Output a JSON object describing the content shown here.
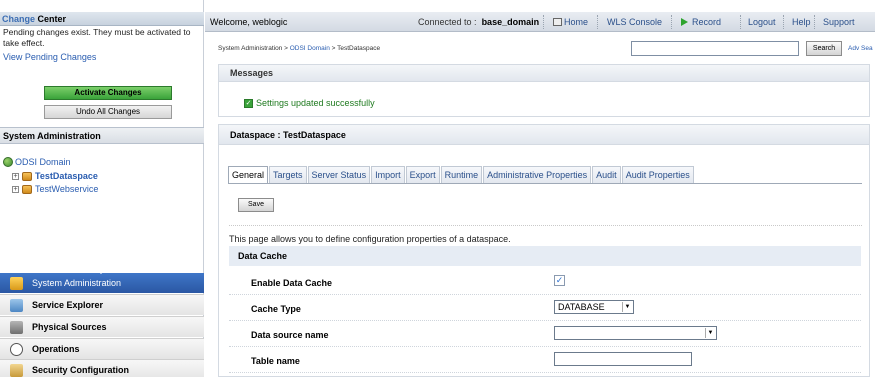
{
  "change_center": {
    "title_prefix": "Change",
    "title_rest": " Center",
    "message": "Pending changes exist. They must be activated to take effect.",
    "view_link": "View Pending Changes",
    "activate_label": "Activate Changes",
    "undo_label": "Undo All Changes"
  },
  "system_admin": {
    "title": "System Administration",
    "tree": {
      "root": "ODSI Domain",
      "items": [
        "TestDataspace",
        "TestWebservice"
      ]
    }
  },
  "left_nav": {
    "items": [
      "System Administration",
      "Service Explorer",
      "Physical Sources",
      "Operations",
      "Security Configuration"
    ]
  },
  "topbar": {
    "welcome": "Welcome, weblogic",
    "connected_label": "Connected to :",
    "domain": "base_domain",
    "links": [
      "Home",
      "WLS Console",
      "Record",
      "Logout",
      "Help",
      "Support"
    ]
  },
  "breadcrumb": {
    "part1": "System Administration > ",
    "part2": "ODSI Domain",
    "part3": " > TestDataspace"
  },
  "search": {
    "button": "Search",
    "advanced": "Adv Sea"
  },
  "messages": {
    "title": "Messages",
    "success": "Settings updated successfully"
  },
  "dataspace": {
    "title": "Dataspace : TestDataspace",
    "tabs": [
      "General",
      "Targets",
      "Server Status",
      "Import",
      "Export",
      "Runtime",
      "Administrative Properties",
      "Audit",
      "Audit Properties"
    ],
    "save_label": "Save",
    "description": "This page allows you to define configuration properties of a dataspace.",
    "section_title": "Data Cache",
    "fields": {
      "enable_cache": "Enable Data Cache",
      "cache_type": "Cache Type",
      "cache_type_value": "DATABASE",
      "data_source": "Data source name",
      "data_source_value": "",
      "table_name": "Table name",
      "table_name_value": ""
    }
  }
}
